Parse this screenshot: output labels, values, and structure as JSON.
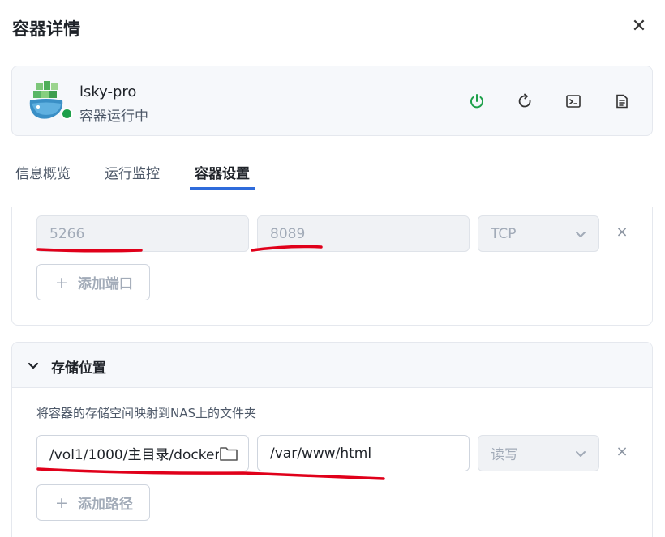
{
  "dialog": {
    "title": "容器详情",
    "close_label": "✕"
  },
  "container": {
    "name": "lsky-pro",
    "status": "容器运行中",
    "status_color": "#1ea04a",
    "icon": "whale-container-icon",
    "actions": [
      {
        "icon": "power-icon",
        "color": "#1ea04a"
      },
      {
        "icon": "restart-icon",
        "color": "#333333"
      },
      {
        "icon": "terminal-icon",
        "color": "#333333"
      },
      {
        "icon": "log-file-icon",
        "color": "#333333"
      }
    ]
  },
  "tabs": [
    {
      "label": "信息概览",
      "active": false
    },
    {
      "label": "运行监控",
      "active": false
    },
    {
      "label": "容器设置",
      "active": true
    }
  ],
  "accent_color": "#2f6bdb",
  "ports": {
    "rows": [
      {
        "host_port": "5266",
        "container_port": "8089",
        "protocol": "TCP"
      }
    ],
    "add_label": "添加端口",
    "remove_label": "×"
  },
  "storage": {
    "title": "存储位置",
    "description": "将容器的存储空间映射到NAS上的文件夹",
    "rows": [
      {
        "host_path": "/vol1/1000/主目录/docker",
        "container_path": "/var/www/html",
        "mode": "读写"
      }
    ],
    "add_label": "添加路径",
    "remove_label": "×"
  },
  "annotation_color": "#e0001a"
}
